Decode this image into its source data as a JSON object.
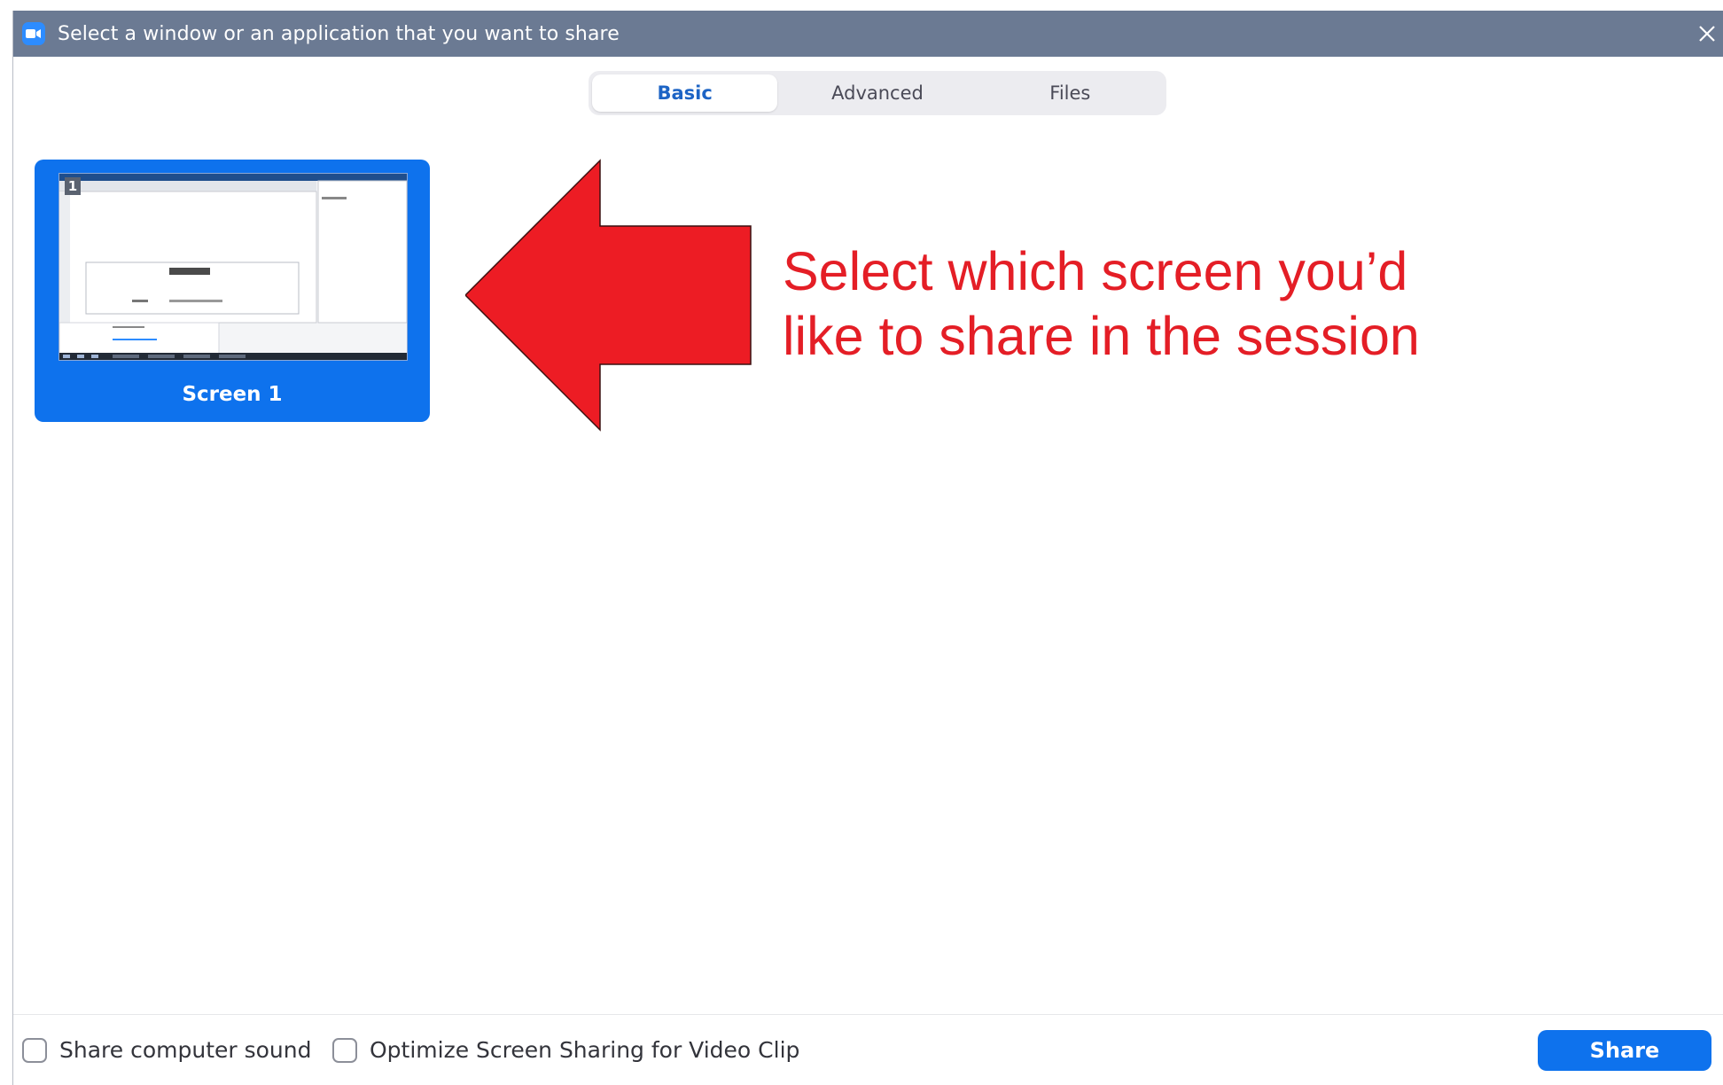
{
  "window": {
    "title": "Select a window or an application that you want to share"
  },
  "tabs": [
    {
      "label": "Basic",
      "active": true
    },
    {
      "label": "Advanced",
      "active": false
    },
    {
      "label": "Files",
      "active": false
    }
  ],
  "screens": [
    {
      "label": "Screen 1",
      "badge": "1",
      "selected": true
    }
  ],
  "annotation": {
    "line1": "Select which screen you’d",
    "line2": "like to share in the session",
    "color": "#e41e26"
  },
  "footer": {
    "share_sound_label": "Share computer sound",
    "share_sound_checked": false,
    "optimize_label": "Optimize Screen Sharing for Video Clip",
    "optimize_checked": false,
    "share_button_label": "Share"
  },
  "colors": {
    "titlebar": "#6b7a93",
    "accent": "#0e72ed",
    "tab_active_text": "#1d64c5"
  }
}
